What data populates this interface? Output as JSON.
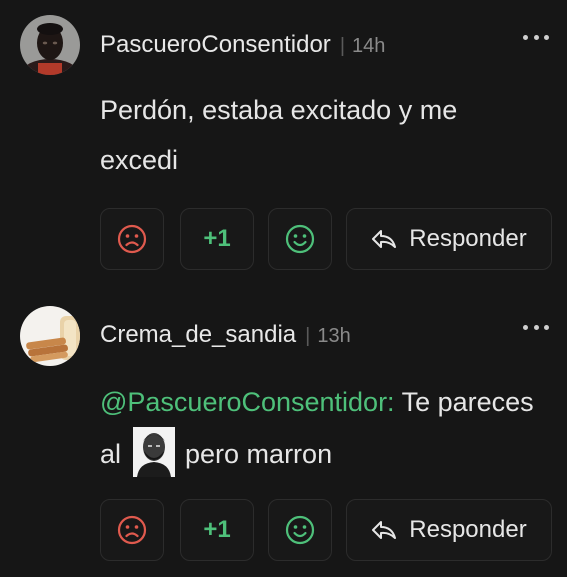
{
  "comments": [
    {
      "username": "PascueroConsentidor",
      "separator": "|",
      "time": "14h",
      "text": "Perdón, estaba excitado y me excedi",
      "actions": {
        "plus_label": "+1",
        "reply_label": "Responder"
      }
    },
    {
      "username": "Crema_de_sandia",
      "separator": "|",
      "time": "13h",
      "mention": "@PascueroConsentidor:",
      "text_part1": "Te pareces al",
      "text_part2": "pero marron",
      "actions": {
        "plus_label": "+1",
        "reply_label": "Responder"
      }
    }
  ],
  "colors": {
    "background": "#161616",
    "accent_green": "#4ec07a",
    "sad_red": "#e05a4e"
  },
  "icons": [
    "more-options-icon",
    "sad-face-icon",
    "happy-face-icon",
    "reply-arrow-icon"
  ]
}
